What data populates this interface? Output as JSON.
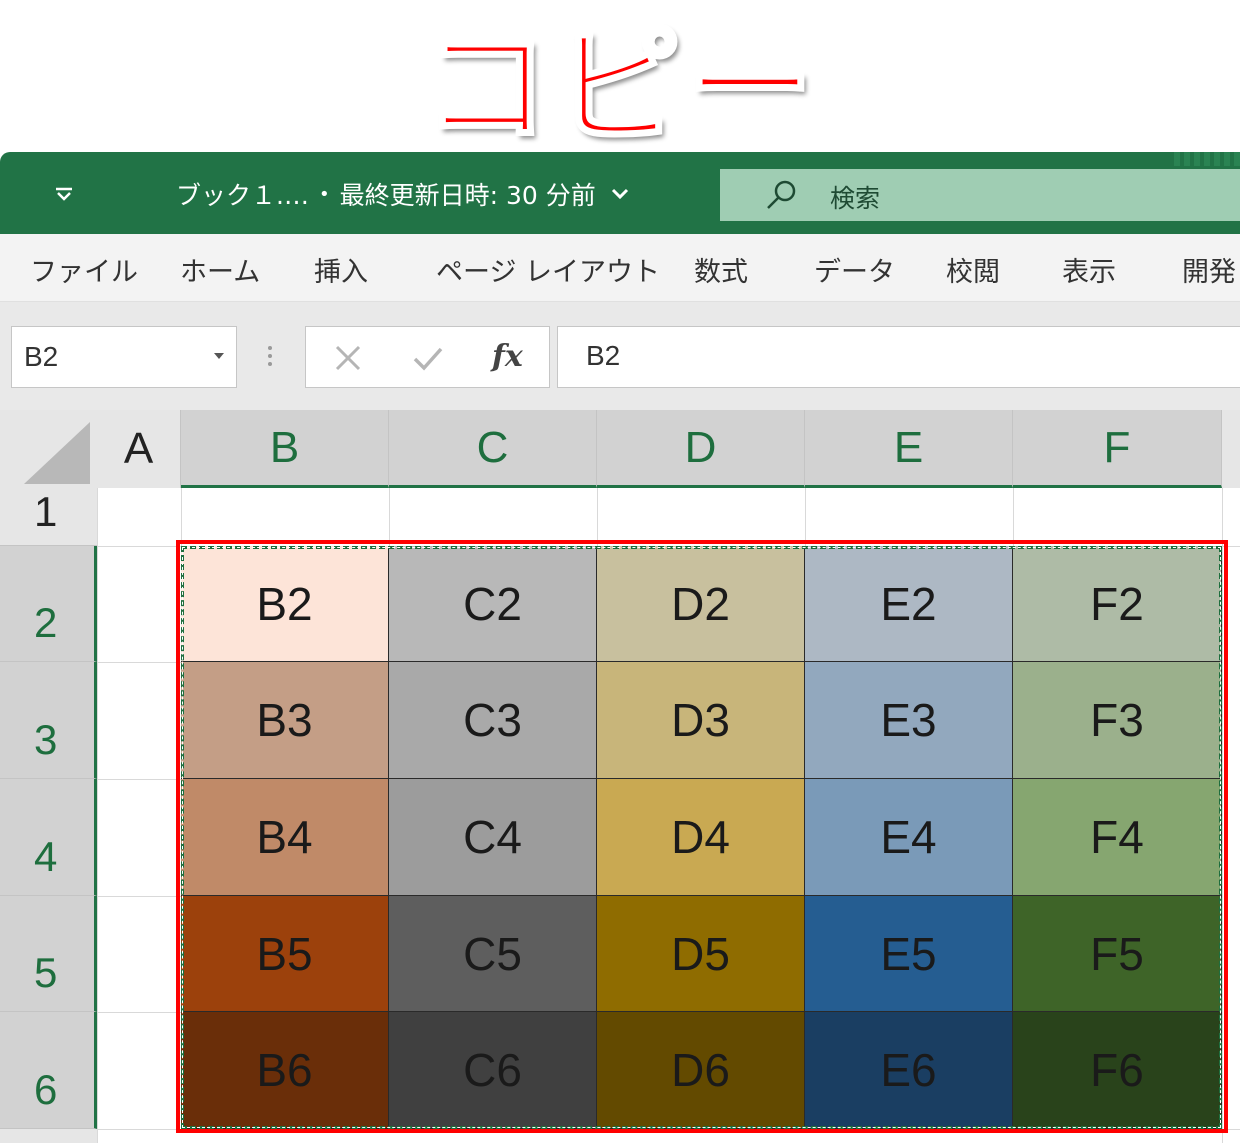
{
  "headline": "コピー",
  "titlebar": {
    "qat_icon": "dropdown-chevron-icon",
    "doc_name": "ブック１.…",
    "separator": "•",
    "saved_status": "最終更新日時: 30 分前",
    "search_placeholder": "検索",
    "colors": {
      "bar": "#217346",
      "search_bg": "#9fcdb3"
    }
  },
  "ribbon": {
    "tabs": [
      "ファイル",
      "ホーム",
      "挿入",
      "ページ レイアウト",
      "数式",
      "データ",
      "校閲",
      "表示",
      "開発"
    ]
  },
  "formula_bar": {
    "name_box": "B2",
    "fx_label": "fx",
    "content": "B2"
  },
  "sheet": {
    "columns": [
      "A",
      "B",
      "C",
      "D",
      "E",
      "F"
    ],
    "rows": [
      "1",
      "2",
      "3",
      "4",
      "5",
      "6"
    ],
    "cells": [
      [
        {
          "text": "B2",
          "fill": "#fde4d8"
        },
        {
          "text": "C2",
          "fill": "#b8b8b8"
        },
        {
          "text": "D2",
          "fill": "#c8c09e"
        },
        {
          "text": "E2",
          "fill": "#adb8c4"
        },
        {
          "text": "F2",
          "fill": "#aebba6"
        }
      ],
      [
        {
          "text": "B3",
          "fill": "#c49e86"
        },
        {
          "text": "C3",
          "fill": "#a9a9a9"
        },
        {
          "text": "D3",
          "fill": "#c8b57a"
        },
        {
          "text": "E3",
          "fill": "#92a8be"
        },
        {
          "text": "F3",
          "fill": "#9bb08c"
        }
      ],
      [
        {
          "text": "B4",
          "fill": "#c08a68"
        },
        {
          "text": "C4",
          "fill": "#9c9c9c"
        },
        {
          "text": "D4",
          "fill": "#c9a952"
        },
        {
          "text": "E4",
          "fill": "#7a9ab8"
        },
        {
          "text": "F4",
          "fill": "#86a670"
        }
      ],
      [
        {
          "text": "B5",
          "fill": "#9c410c"
        },
        {
          "text": "C5",
          "fill": "#5e5e5e"
        },
        {
          "text": "D5",
          "fill": "#8f6c00"
        },
        {
          "text": "E5",
          "fill": "#255d91"
        },
        {
          "text": "F5",
          "fill": "#3e6428"
        }
      ],
      [
        {
          "text": "B6",
          "fill": "#6a2e09"
        },
        {
          "text": "C6",
          "fill": "#404040"
        },
        {
          "text": "D6",
          "fill": "#634a00"
        },
        {
          "text": "E6",
          "fill": "#1a3e62"
        },
        {
          "text": "F6",
          "fill": "#29431b"
        }
      ]
    ]
  }
}
